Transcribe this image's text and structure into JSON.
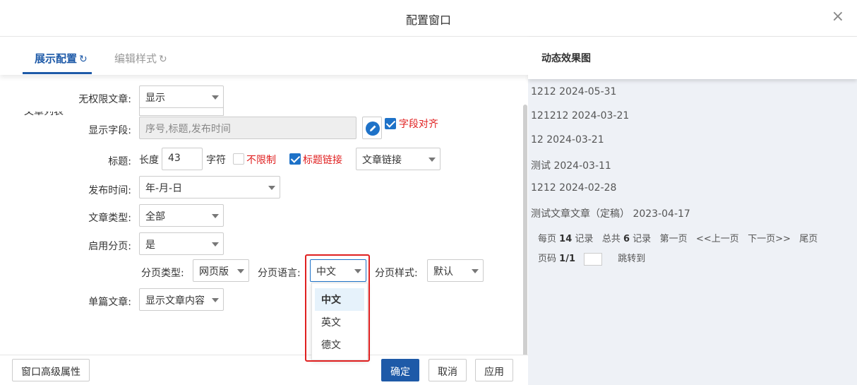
{
  "window": {
    "title": "配置窗口",
    "close_label": "×"
  },
  "tabs": [
    {
      "label": "展示配置",
      "refresh": "↻"
    },
    {
      "label": "编辑样式",
      "refresh": "↻"
    }
  ],
  "form": {
    "partial_label": "文章列表",
    "no_permission": {
      "label": "无权限文章:",
      "value": "显示"
    },
    "display_fields": {
      "label": "显示字段:",
      "value": "序号,标题,发布时间",
      "align_label": "字段对齐"
    },
    "title": {
      "label": "标题:",
      "length_label": "长度",
      "length_value": "43",
      "unit": "字符",
      "unlimited_label": "不限制",
      "link_label": "标题链接",
      "link_type": "文章链接"
    },
    "publish_time": {
      "label": "发布时间:",
      "value": "年-月-日"
    },
    "article_type": {
      "label": "文章类型:",
      "value": "全部"
    },
    "pagination": {
      "label": "启用分页:",
      "value": "是"
    },
    "page_type": {
      "label": "分页类型:",
      "value": "网页版"
    },
    "page_lang": {
      "label": "分页语言:",
      "value": "中文",
      "options": [
        "中文",
        "英文",
        "德文"
      ]
    },
    "page_style": {
      "label": "分页样式:",
      "value": "默认"
    },
    "single_article": {
      "label": "单篇文章:",
      "value": "显示文章内容"
    }
  },
  "footer": {
    "advanced": "窗口高级属性",
    "ok": "确定",
    "cancel": "取消",
    "apply": "应用"
  },
  "preview": {
    "title": "动态效果图",
    "articles": [
      "1212 2024-05-31",
      "121212 2024-03-21",
      "12 2024-03-21",
      "测试 2024-03-11",
      "1212 2024-02-28",
      "测试文章文章（定稿） 2023-04-17"
    ],
    "pager": {
      "per_page_pre": "每页",
      "per_page_num": "14",
      "per_page_post": "记录",
      "total_pre": "总共",
      "total_num": "6",
      "total_post": "记录",
      "first": "第一页",
      "prev": "<<上一页",
      "next": "下一页>>",
      "last": "尾页",
      "page_pre": "页码",
      "page_num": "1/1",
      "jump": "跳转到"
    }
  },
  "colors": {
    "accent": "#1e5aa8",
    "highlight": "#e02020",
    "preview_bg": "#eef1f6"
  }
}
